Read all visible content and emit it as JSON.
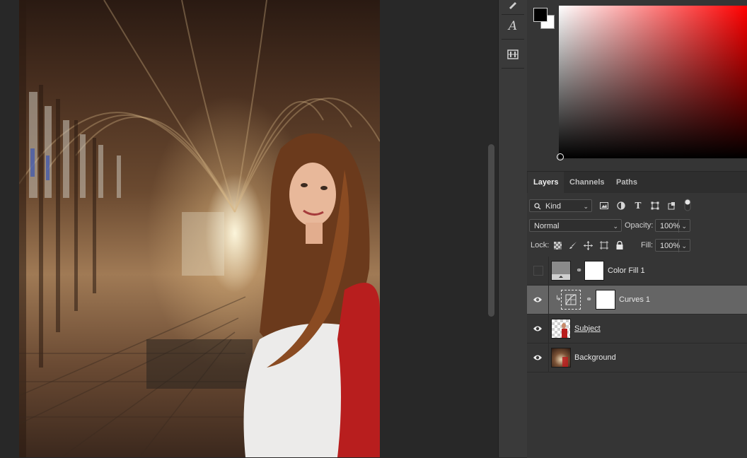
{
  "tool_strip": {
    "icons": [
      "brush-icon",
      "text-style-icon",
      "adjustments-grid-icon"
    ],
    "text_icon_glyph": "A"
  },
  "color_panel": {
    "foreground_color": "#000000",
    "background_color": "#ffffff",
    "hue_color": "#ff0000"
  },
  "layers_panel": {
    "tabs": [
      {
        "label": "Layers",
        "active": true
      },
      {
        "label": "Channels",
        "active": false
      },
      {
        "label": "Paths",
        "active": false
      }
    ],
    "filter": {
      "kind_label": "Kind"
    },
    "blend_mode": "Normal",
    "opacity": {
      "label": "Opacity:",
      "value": "100%"
    },
    "lock_label": "Lock:",
    "fill": {
      "label": "Fill:",
      "value": "100%"
    },
    "layers": [
      {
        "name": "Color Fill 1",
        "visible": false,
        "selected": false,
        "type": "fill"
      },
      {
        "name": "Curves 1",
        "visible": true,
        "selected": true,
        "type": "adjustment"
      },
      {
        "name": "Subject",
        "visible": true,
        "selected": false,
        "type": "pixel"
      },
      {
        "name": "Background",
        "visible": true,
        "selected": false,
        "type": "pixel"
      }
    ]
  },
  "colors": {
    "app_bg": "#282828",
    "panel_bg": "#353535",
    "selected_row": "#656565",
    "subject_cardigan": "#b81e1e"
  }
}
